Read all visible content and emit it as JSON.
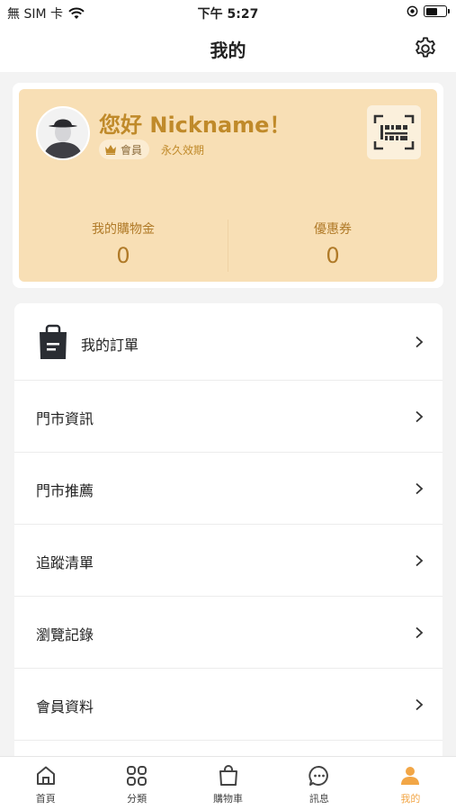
{
  "status_bar": {
    "carrier": "無 SIM 卡",
    "time": "下午 5:27"
  },
  "nav": {
    "title": "我的"
  },
  "member": {
    "greeting": "您好 Nickname！",
    "badge": "會員",
    "validity": "永久效期",
    "credit_label": "我的購物金",
    "credit_value": "0",
    "coupon_label": "優惠券",
    "coupon_value": "0"
  },
  "menu": {
    "items": [
      {
        "label": "我的訂單"
      },
      {
        "label": "門市資訊"
      },
      {
        "label": "門市推薦"
      },
      {
        "label": "追蹤清單"
      },
      {
        "label": "瀏覽記錄"
      },
      {
        "label": "會員資料"
      }
    ]
  },
  "tabs": [
    {
      "label": "首頁",
      "icon": "home-icon"
    },
    {
      "label": "分類",
      "icon": "grid-icon"
    },
    {
      "label": "購物車",
      "icon": "shopping-bag-icon"
    },
    {
      "label": "訊息",
      "icon": "chat-icon"
    },
    {
      "label": "我的",
      "icon": "user-icon"
    }
  ],
  "colors": {
    "accent": "#f2a646",
    "card_bg": "#f8dfb5",
    "card_text": "#c08a2a"
  }
}
